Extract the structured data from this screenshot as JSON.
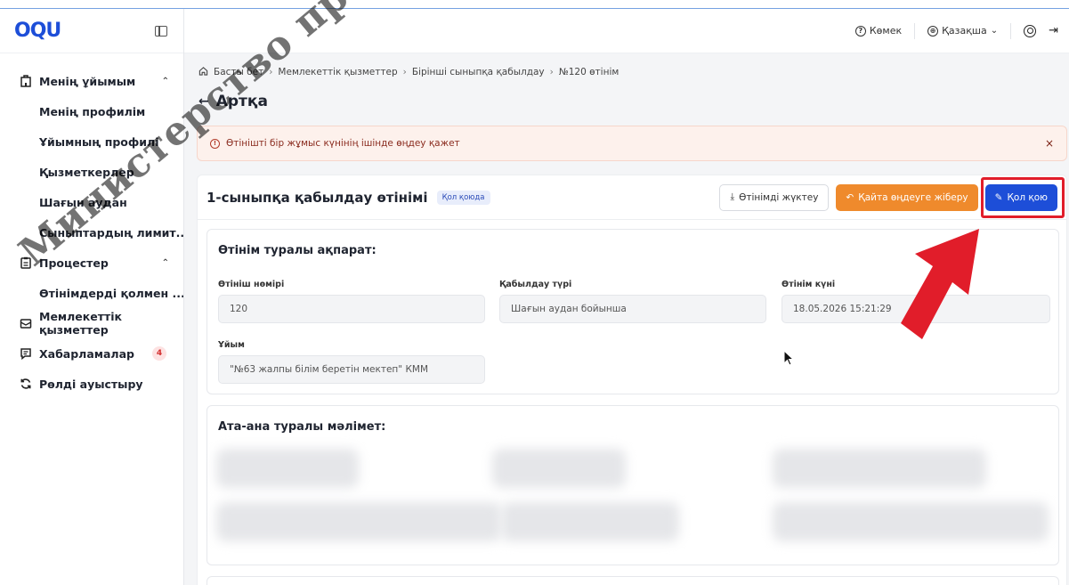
{
  "app": {
    "logo": "OQU"
  },
  "sidebar": {
    "groups": [
      {
        "label": "Менің ұйымым",
        "icon": "building-icon",
        "expanded": true,
        "items": [
          "Менің профилім",
          "Ұйымның профилі",
          "Қызметкерлер",
          "Шағын аудан",
          "Сыныптардың лимит..."
        ]
      },
      {
        "label": "Процестер",
        "icon": "clipboard-icon",
        "expanded": true,
        "items": [
          "Өтінімдерді қолмен ..."
        ]
      },
      {
        "label": "Мемлекеттік қызметтер",
        "icon": "mail-icon"
      },
      {
        "label": "Хабарламалар",
        "icon": "message-icon",
        "badge": "4"
      },
      {
        "label": "Рөлді ауыстыру",
        "icon": "refresh-icon"
      }
    ]
  },
  "header": {
    "help_label": "Көмек",
    "language_label": "Қазақша"
  },
  "breadcrumb": [
    "Басты бет",
    "Мемлекеттік қызметтер",
    "Бірінші сыныпқа қабылдау",
    "№120 өтінім"
  ],
  "back_label": "Артқа",
  "alert": {
    "text": "Өтінішті бір жұмыс күнінің ішінде өңдеу қажет",
    "close": "×"
  },
  "application": {
    "title": "1-сыныпқа қабылдау өтінімі",
    "status": "Қол қоюда",
    "buttons": {
      "download": "Өтінімді жүктеу",
      "return": "Қайта өңдеуге жіберу",
      "sign": "Қол қою"
    }
  },
  "info_section": {
    "title": "Өтінім туралы ақпарат:",
    "fields": [
      {
        "label": "Өтініш нөмірі",
        "value": "120"
      },
      {
        "label": "Қабылдау түрі",
        "value": "Шағын аудан бойынша"
      },
      {
        "label": "Өтінім күні",
        "value": "18.05.2026 15:21:29"
      },
      {
        "label": "Ұйым",
        "value": "\"№63 жалпы білім беретін мектеп\" КММ"
      }
    ]
  },
  "parent_section": {
    "title": "Ата-ана туралы мәлімет:"
  },
  "watermark": "Министерство просвещения Республики",
  "colors": {
    "primary": "#1d4ed8",
    "orange": "#ef8a2c",
    "alert_bg": "#fdf1ec",
    "highlight": "#e11d2a"
  }
}
